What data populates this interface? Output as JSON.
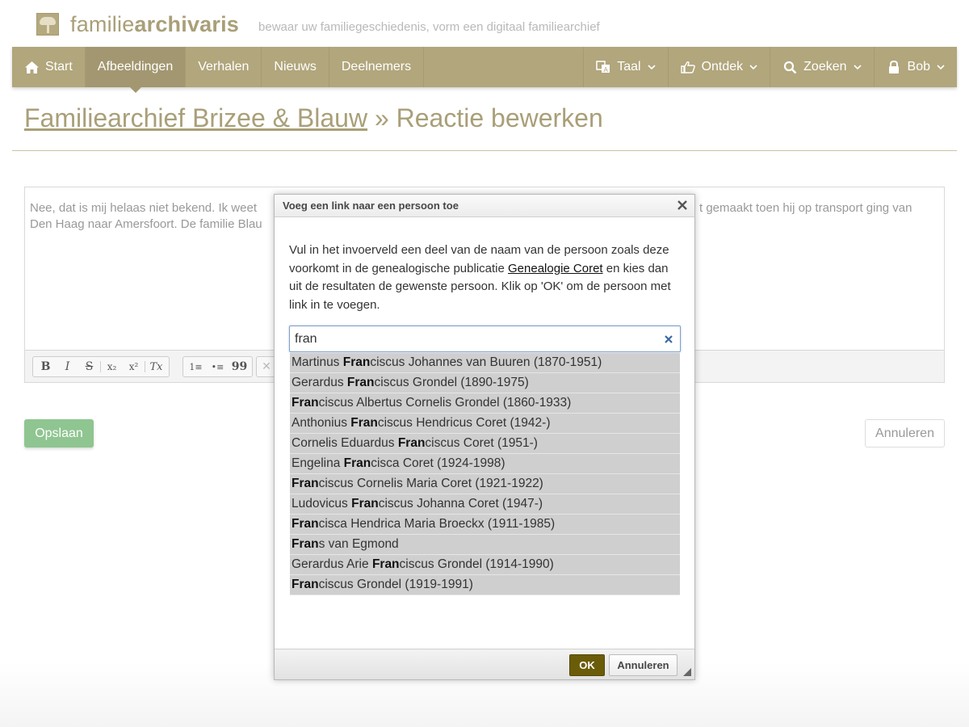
{
  "header": {
    "brand_light": "familie",
    "brand_bold": "archivaris",
    "tagline": "bewaar uw familiegeschiedenis, vorm een digitaal familiearchief"
  },
  "nav": {
    "left": [
      {
        "label": "Start",
        "icon": "home-icon"
      },
      {
        "label": "Afbeeldingen",
        "active": true
      },
      {
        "label": "Verhalen"
      },
      {
        "label": "Nieuws"
      },
      {
        "label": "Deelnemers"
      }
    ],
    "right": [
      {
        "label": "Taal",
        "icon": "translate-icon"
      },
      {
        "label": "Ontdek",
        "icon": "thumbs-up-icon"
      },
      {
        "label": "Zoeken",
        "icon": "search-icon"
      },
      {
        "label": "Bob",
        "icon": "lock-icon"
      }
    ]
  },
  "title": {
    "crumb": "Familiearchief Brizee & Blauw",
    "separator": " » ",
    "current": "Reactie bewerken"
  },
  "editor": {
    "text_line1_start": "Nee, dat is mij helaas niet bekend. Ik weet",
    "text_line1_end": "t gemaakt toen hij op transport ging van",
    "text_line2_start": "Den Haag naar Amersfoort. De familie Blau"
  },
  "toolbar": {
    "bold": "B",
    "italic": "I",
    "strike": "S",
    "subscript": "x₂",
    "superscript": "x²",
    "remove_format": "Tx",
    "numbered_list": "1≡",
    "bulleted_list": "•≡",
    "blockquote": "99"
  },
  "actions": {
    "save": "Opslaan",
    "cancel": "Annuleren"
  },
  "dialog": {
    "title": "Voeg een link naar een persoon toe",
    "intro_before": "Vul in het invoerveld een deel van de naam van de persoon zoals deze voorkomt in de genealogische publicatie ",
    "intro_link": "Genealogie Coret",
    "intro_after": " en kies dan uit de resultaten de gewenste persoon. Klik op 'OK' om de persoon met link in te voegen.",
    "search_value": "fran",
    "ok": "OK",
    "cancel": "Annuleren",
    "results": [
      {
        "before": "Martinus ",
        "match": "Fran",
        "after": "ciscus Johannes van Buuren (1870-1951)"
      },
      {
        "before": "Gerardus ",
        "match": "Fran",
        "after": "ciscus Grondel (1890-1975)"
      },
      {
        "before": "",
        "match": "Fran",
        "after": "ciscus Albertus Cornelis Grondel (1860-1933)"
      },
      {
        "before": "Anthonius ",
        "match": "Fran",
        "after": "ciscus Hendricus Coret (1942-)"
      },
      {
        "before": "Cornelis Eduardus ",
        "match": "Fran",
        "after": "ciscus Coret (1951-)"
      },
      {
        "before": "Engelina ",
        "match": "Fran",
        "after": "cisca Coret (1924-1998)"
      },
      {
        "before": "",
        "match": "Fran",
        "after": "ciscus Cornelis Maria Coret (1921-1922)"
      },
      {
        "before": "Ludovicus ",
        "match": "Fran",
        "after": "ciscus Johanna Coret (1947-)"
      },
      {
        "before": "",
        "match": "Fran",
        "after": "cisca Hendrica Maria Broeckx (1911-1985)"
      },
      {
        "before": "",
        "match": "Fran",
        "after": "s van Egmond"
      },
      {
        "before": "Gerardus Arie ",
        "match": "Fran",
        "after": "ciscus Grondel (1914-1990)"
      },
      {
        "before": "",
        "match": "Fran",
        "after": "ciscus Grondel (1919-1991)"
      }
    ]
  },
  "colors": {
    "brand": "#a99f78",
    "navbar": "#b1a67c",
    "navbar_active": "#a29770",
    "save_green": "#8fc590",
    "ok_button": "#6b5c0a",
    "result_bg": "#cfcfcf"
  }
}
